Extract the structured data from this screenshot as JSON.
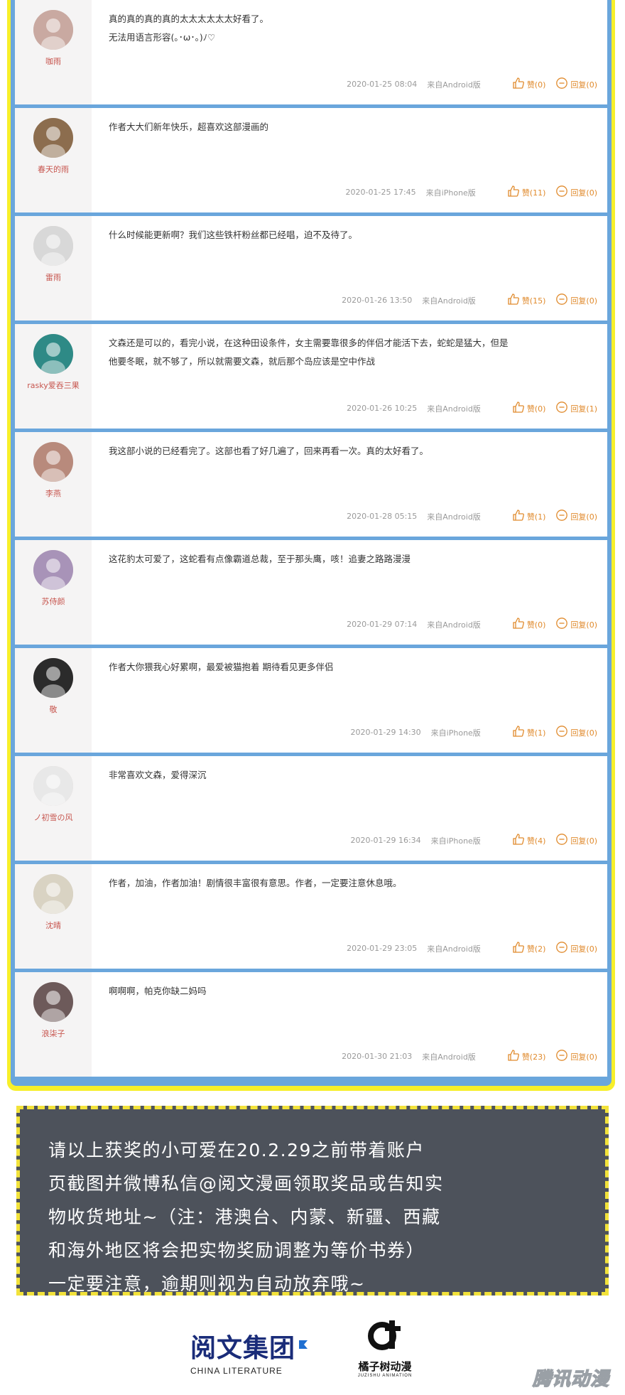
{
  "comments": [
    {
      "user": "咖雨",
      "text_lines": [
        "真的真的真的真的太太太太太太好看了。",
        "无法用语言形容(｡･ω･｡)ﾉ♡"
      ],
      "time": "2020-01-25 08:04",
      "source": "来自Android版",
      "like": "赞(0)",
      "reply": "回复(0)",
      "avatar_color": "#c9a9a1"
    },
    {
      "user": "春天的雨",
      "text_lines": [
        "作者大大们新年快乐，超喜欢这部漫画的"
      ],
      "time": "2020-01-25 17:45",
      "source": "来自iPhone版",
      "like": "赞(11)",
      "reply": "回复(0)",
      "avatar_color": "#8c6d4e"
    },
    {
      "user": "雷雨",
      "text_lines": [
        "什么时候能更新啊？我们这些铁杆粉丝都已经唱，迫不及待了。"
      ],
      "time": "2020-01-26 13:50",
      "source": "来自Android版",
      "like": "赞(15)",
      "reply": "回复(0)",
      "avatar_color": "#d8d8d8"
    },
    {
      "user": "rasky爱吞三果",
      "text_lines": [
        "文森还是可以的，看完小说，在这种田设条件，女主需要靠很多的伴侣才能活下去，蛇蛇是猛大，但是",
        "他要冬眠，就不够了，所以就需要文森，就后那个岛应该是空中作战"
      ],
      "time": "2020-01-26 10:25",
      "source": "来自Android版",
      "like": "赞(0)",
      "reply": "回复(1)",
      "avatar_color": "#2e8a86"
    },
    {
      "user": "李燕",
      "text_lines": [
        "我这部小说的已经看完了。这部也看了好几遍了，回来再看一次。真的太好看了。"
      ],
      "time": "2020-01-28 05:15",
      "source": "来自Android版",
      "like": "赞(1)",
      "reply": "回复(0)",
      "avatar_color": "#b88a7c"
    },
    {
      "user": "苏侍颜",
      "text_lines": [
        "这花豹太可爱了，这蛇看有点像霸道总裁，至于那头鹰，咳！追妻之路路漫漫"
      ],
      "time": "2020-01-29 07:14",
      "source": "来自Android版",
      "like": "赞(0)",
      "reply": "回复(0)",
      "avatar_color": "#a893b8"
    },
    {
      "user": "敬",
      "text_lines": [
        "作者大你猥我心好累啊，最爱被猫抱着 期待看见更多伴侣"
      ],
      "time": "2020-01-29 14:30",
      "source": "来自iPhone版",
      "like": "赞(1)",
      "reply": "回复(0)",
      "avatar_color": "#2b2b2b"
    },
    {
      "user": "ノ初雪の风",
      "text_lines": [
        "非常喜欢文森，爱得深沉"
      ],
      "time": "2020-01-29 16:34",
      "source": "来自iPhone版",
      "like": "赞(4)",
      "reply": "回复(0)",
      "avatar_color": "#e8e8e8"
    },
    {
      "user": "沈晴",
      "text_lines": [
        "作者，加油，作者加油！剧情很丰富很有意思。作者，一定要注意休息哦。"
      ],
      "time": "2020-01-29 23:05",
      "source": "来自Android版",
      "like": "赞(2)",
      "reply": "回复(0)",
      "avatar_color": "#d9d3c3"
    },
    {
      "user": "浪柒子",
      "text_lines": [
        "啊啊啊，帕克你缺二妈吗"
      ],
      "time": "2020-01-30 21:03",
      "source": "来自Android版",
      "like": "赞(23)",
      "reply": "回复(0)",
      "avatar_color": "#6d5a5a"
    }
  ],
  "notice": {
    "lines": [
      "请以上获奖的小可爱在20.2.29之前带着账户",
      "页截图并微博私信@阅文漫画领取奖品或告知实",
      "物收货地址~（注：港澳台、内蒙、新疆、西藏",
      "和海外地区将会把实物奖励调整为等价书券）",
      "一定要注意，逾期则视为自动放弃哦~"
    ]
  },
  "logos": {
    "china_literature_cn": "阅文集团",
    "china_literature_en": "CHINA LITERATURE",
    "juzishu_cn": "橘子树动漫",
    "juzishu_en": "JUZISHU ANIMATION",
    "watermark": "腾讯动漫"
  },
  "colors": {
    "frame_yellow": "#f7ef2a",
    "frame_blue": "#6aa6dc",
    "username": "#c7564f",
    "action": "#e08a2c",
    "notice_bg": "#4d525b"
  }
}
